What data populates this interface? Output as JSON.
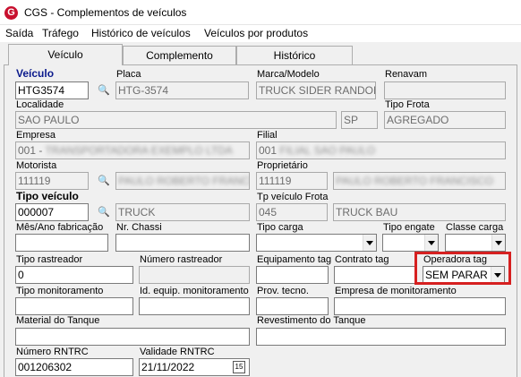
{
  "window": {
    "title": "CGS - Complementos de veículos",
    "app_icon": "G"
  },
  "menu": [
    "Saída",
    "Tráfego",
    "Histórico de veículos",
    "Veículos por produtos"
  ],
  "tabs": [
    "Veículo",
    "Complemento",
    "Histórico"
  ],
  "active_tab": "Veículo",
  "fields": {
    "veiculo": {
      "label": "Veículo",
      "value": "HTG3574"
    },
    "placa": {
      "label": "Placa",
      "value": "HTG-3574"
    },
    "marca_modelo": {
      "label": "Marca/Modelo",
      "value": "TRUCK SIDER RANDON"
    },
    "renavam": {
      "label": "Renavam",
      "value": ""
    },
    "localidade": {
      "label": "Localidade",
      "value": "SAO PAULO",
      "uf": "SP"
    },
    "tipo_frota": {
      "label": "Tipo Frota",
      "value": "AGREGADO"
    },
    "empresa": {
      "label": "Empresa",
      "value": "001 - ",
      "hidden_text": "TRANSPORTADORA EXEMPLO LTDA"
    },
    "filial": {
      "label": "Filial",
      "value": "001",
      "hidden_text": "FILIAL SAO PAULO"
    },
    "motorista": {
      "label": "Motorista",
      "value": "111119",
      "hidden_text": "PAULO ROBERTO FRANCISCO"
    },
    "proprietario": {
      "label": "Proprietário",
      "value": "111119",
      "hidden_text": "PAULO ROBERTO FRANCISCO"
    },
    "tipo_veiculo": {
      "label": "Tipo veículo",
      "value": "000007",
      "desc": "TRUCK"
    },
    "tp_veiculo_frota": {
      "label": "Tp veículo Frota",
      "value": "045",
      "desc": "TRUCK BAU"
    },
    "mes_ano_fabricacao": {
      "label": "Mês/Ano fabricação",
      "value": ""
    },
    "nr_chassi": {
      "label": "Nr. Chassi",
      "value": ""
    },
    "tipo_carga": {
      "label": "Tipo carga",
      "value": ""
    },
    "tipo_engate": {
      "label": "Tipo engate",
      "value": ""
    },
    "classe_carga": {
      "label": "Classe carga",
      "value": ""
    },
    "tipo_rastreador": {
      "label": "Tipo rastreador",
      "value": "0"
    },
    "numero_rastreador": {
      "label": "Número rastreador",
      "value": ""
    },
    "equipamento_tag": {
      "label": "Equipamento tag",
      "value": ""
    },
    "contrato_tag": {
      "label": "Contrato tag",
      "value": ""
    },
    "operadora_tag": {
      "label": "Operadora tag",
      "value": "SEM PARAR"
    },
    "tipo_monitoramento": {
      "label": "Tipo monitoramento",
      "value": ""
    },
    "id_equip_monitoramento": {
      "label": "Id. equip. monitoramento",
      "value": ""
    },
    "prov_tecno": {
      "label": "Prov. tecno.",
      "value": ""
    },
    "empresa_monitoramento": {
      "label": "Empresa de monitoramento",
      "value": ""
    },
    "material_tanque": {
      "label": "Material do Tanque",
      "value": ""
    },
    "revestimento_tanque": {
      "label": "Revestimento do Tanque",
      "value": ""
    },
    "numero_rntrc": {
      "label": "Número RNTRC",
      "value": "001206302"
    },
    "validade_rntrc": {
      "label": "Validade RNTRC",
      "value": "21/11/2022"
    }
  },
  "icons": {
    "lookup": "binoculars-icon",
    "calendar": "calendar-icon",
    "calendar_glyph": "15",
    "combo": "chevron-down-icon"
  },
  "colors": {
    "highlight": "#d62020",
    "label_blue": "#0b1a8c",
    "app_icon": "#c8102e"
  }
}
